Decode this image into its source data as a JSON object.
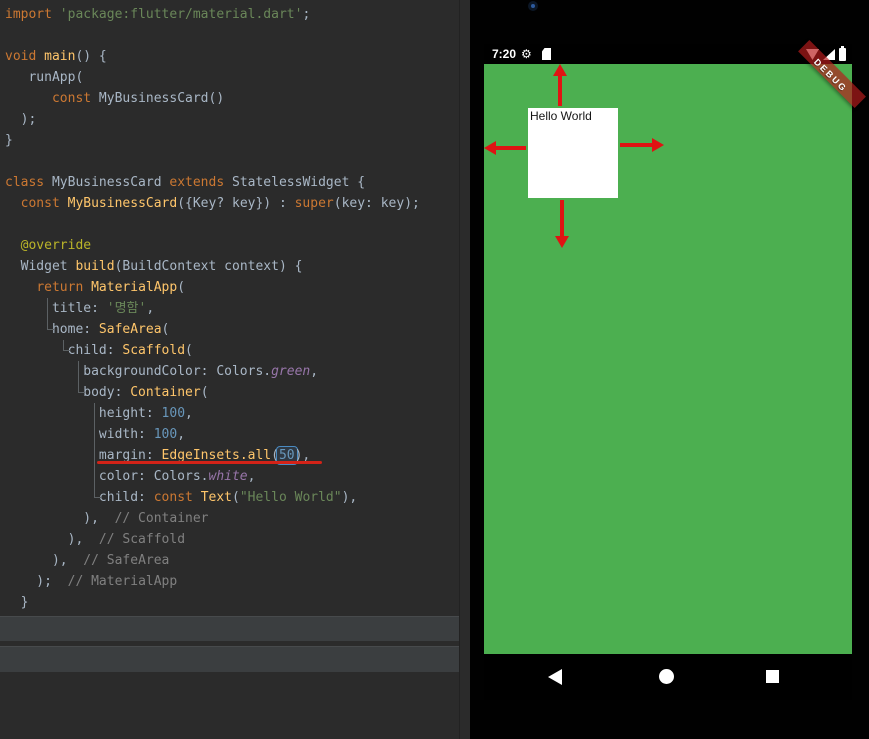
{
  "colors": {
    "editor_background": "#2b2b2b",
    "app_background_green": "#4caf50",
    "container_white": "#ffffff",
    "debug_banner_red": "rgba(183,28,28,0.68)",
    "annotation_arrow_red": "#e01313",
    "keyword_orange": "#cc7832",
    "string_green": "#6a8759",
    "number_blue": "#6897bb",
    "comment_gray": "#808080"
  },
  "editor": {
    "code_lines": [
      {
        "segments": [
          {
            "t": "import ",
            "c": "kw"
          },
          {
            "t": "'package:flutter/material.dart'",
            "c": "str"
          },
          {
            "t": ";",
            "c": "pl"
          }
        ]
      },
      {
        "segments": []
      },
      {
        "segments": [
          {
            "t": "void ",
            "c": "kw"
          },
          {
            "t": "main",
            "c": "fn"
          },
          {
            "t": "() {",
            "c": "pl"
          }
        ]
      },
      {
        "segments": [
          {
            "t": "   runApp(",
            "c": "pl"
          }
        ]
      },
      {
        "segments": [
          {
            "t": "      ",
            "c": "pl"
          },
          {
            "t": "const",
            "c": "kw"
          },
          {
            "t": " MyBusinessCard()",
            "c": "pl"
          }
        ]
      },
      {
        "segments": [
          {
            "t": "  );",
            "c": "pl"
          }
        ]
      },
      {
        "segments": [
          {
            "t": "}",
            "c": "pl"
          }
        ]
      },
      {
        "segments": []
      },
      {
        "segments": [
          {
            "t": "class",
            "c": "kw"
          },
          {
            "t": " MyBusinessCard ",
            "c": "pl"
          },
          {
            "t": "extends",
            "c": "kw"
          },
          {
            "t": " StatelessWidget {",
            "c": "pl"
          }
        ]
      },
      {
        "segments": [
          {
            "t": "  ",
            "c": "pl"
          },
          {
            "t": "const",
            "c": "kw"
          },
          {
            "t": " ",
            "c": "pl"
          },
          {
            "t": "MyBusinessCard",
            "c": "fn"
          },
          {
            "t": "({Key? key}) : ",
            "c": "pl"
          },
          {
            "t": "super",
            "c": "kw"
          },
          {
            "t": "(key: key);",
            "c": "pl"
          }
        ]
      },
      {
        "segments": []
      },
      {
        "segments": [
          {
            "t": "  ",
            "c": "pl"
          },
          {
            "t": "@override",
            "c": "ann"
          }
        ]
      },
      {
        "segments": [
          {
            "t": "  Widget ",
            "c": "pl"
          },
          {
            "t": "build",
            "c": "fn"
          },
          {
            "t": "(BuildContext context) {",
            "c": "pl"
          }
        ]
      },
      {
        "segments": [
          {
            "t": "    ",
            "c": "pl"
          },
          {
            "t": "return",
            "c": "kw"
          },
          {
            "t": " ",
            "c": "pl"
          },
          {
            "t": "MaterialApp",
            "c": "fn"
          },
          {
            "t": "(",
            "c": "pl"
          }
        ]
      },
      {
        "segments": [
          {
            "t": "      title: ",
            "c": "pl"
          },
          {
            "t": "'명함'",
            "c": "str"
          },
          {
            "t": ",",
            "c": "pl"
          }
        ]
      },
      {
        "segments": [
          {
            "t": "      home: ",
            "c": "pl"
          },
          {
            "t": "SafeArea",
            "c": "fn"
          },
          {
            "t": "(",
            "c": "pl"
          }
        ]
      },
      {
        "segments": [
          {
            "t": "        child: ",
            "c": "pl"
          },
          {
            "t": "Scaffold",
            "c": "fn"
          },
          {
            "t": "(",
            "c": "pl"
          }
        ]
      },
      {
        "segments": [
          {
            "t": "          backgroundColor: Colors.",
            "c": "pl"
          },
          {
            "t": "green",
            "c": "mem"
          },
          {
            "t": ",",
            "c": "pl"
          }
        ]
      },
      {
        "segments": [
          {
            "t": "          body: ",
            "c": "pl"
          },
          {
            "t": "Container",
            "c": "fn"
          },
          {
            "t": "(",
            "c": "pl"
          }
        ]
      },
      {
        "segments": [
          {
            "t": "            height: ",
            "c": "pl"
          },
          {
            "t": "100",
            "c": "num"
          },
          {
            "t": ",",
            "c": "pl"
          }
        ]
      },
      {
        "segments": [
          {
            "t": "            width: ",
            "c": "pl"
          },
          {
            "t": "100",
            "c": "num"
          },
          {
            "t": ",",
            "c": "pl"
          }
        ]
      },
      {
        "segments": [
          {
            "t": "            margin: ",
            "c": "pl"
          },
          {
            "t": "EdgeInsets.all",
            "c": "fn"
          },
          {
            "t": "(",
            "c": "pl"
          },
          {
            "t": "50",
            "c": "num",
            "box": true
          },
          {
            "t": "),",
            "c": "pl"
          }
        ]
      },
      {
        "segments": [
          {
            "t": "            color: Colors.",
            "c": "pl"
          },
          {
            "t": "white",
            "c": "mem"
          },
          {
            "t": ",",
            "c": "pl"
          }
        ]
      },
      {
        "segments": [
          {
            "t": "            child: ",
            "c": "pl"
          },
          {
            "t": "const",
            "c": "kw"
          },
          {
            "t": " ",
            "c": "pl"
          },
          {
            "t": "Text",
            "c": "fn"
          },
          {
            "t": "(",
            "c": "pl"
          },
          {
            "t": "\"Hello World\"",
            "c": "str"
          },
          {
            "t": "),",
            "c": "pl"
          }
        ]
      },
      {
        "segments": [
          {
            "t": "          ),  ",
            "c": "pl"
          },
          {
            "t": "// Container",
            "c": "cmt"
          }
        ]
      },
      {
        "segments": [
          {
            "t": "        ),  ",
            "c": "pl"
          },
          {
            "t": "// Scaffold",
            "c": "cmt"
          }
        ]
      },
      {
        "segments": [
          {
            "t": "      ),  ",
            "c": "pl"
          },
          {
            "t": "// SafeArea",
            "c": "cmt"
          }
        ]
      },
      {
        "segments": [
          {
            "t": "    );  ",
            "c": "pl"
          },
          {
            "t": "// MaterialApp",
            "c": "cmt"
          }
        ]
      },
      {
        "segments": [
          {
            "t": "  }",
            "c": "pl"
          }
        ]
      }
    ]
  },
  "emulator": {
    "status_bar": {
      "time": "7:20"
    },
    "debug_banner": {
      "label": "DEBUG"
    },
    "app": {
      "text": "Hello World"
    }
  }
}
